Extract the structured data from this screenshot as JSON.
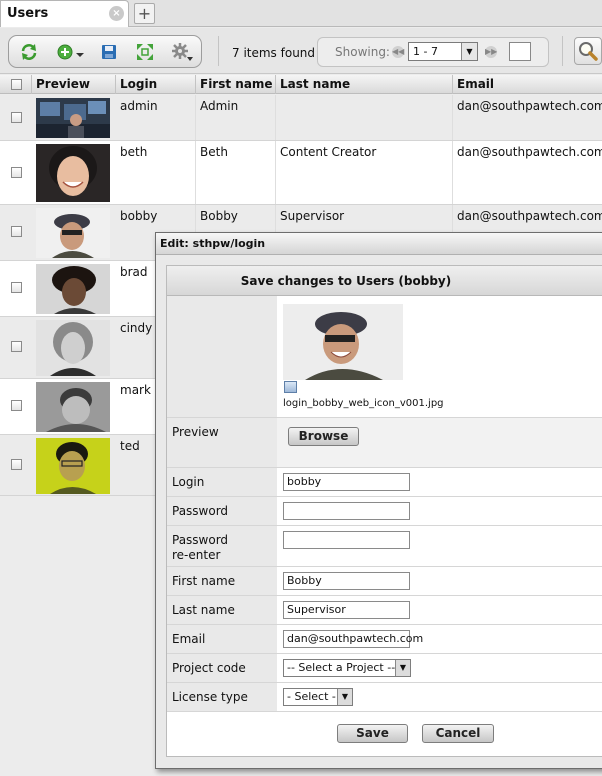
{
  "tab": {
    "title": "Users",
    "close": "×",
    "add": "+"
  },
  "toolbar": {
    "items_found": "7 items found",
    "showing_label": "Showing:",
    "page_range": "1 - 7",
    "page_input": ""
  },
  "table": {
    "headers": [
      "Preview",
      "Login",
      "First name",
      "Last name",
      "Email"
    ],
    "rows": [
      {
        "login": "admin",
        "first_name": "Admin",
        "last_name": "",
        "email": "dan@southpawtech.com"
      },
      {
        "login": "beth",
        "first_name": "Beth",
        "last_name": "Content Creator",
        "email": "dan@southpawtech.com"
      },
      {
        "login": "bobby",
        "first_name": "Bobby",
        "last_name": "Supervisor",
        "email": "dan@southpawtech.com"
      },
      {
        "login": "brad",
        "first_name": "",
        "last_name": "",
        "email": ""
      },
      {
        "login": "cindy",
        "first_name": "",
        "last_name": "",
        "email": ""
      },
      {
        "login": "mark",
        "first_name": "",
        "last_name": "",
        "email": ""
      },
      {
        "login": "ted",
        "first_name": "",
        "last_name": "",
        "email": ""
      }
    ]
  },
  "popup": {
    "title": "Edit: sthpw/login",
    "form_title": "Save changes to Users (bobby)",
    "filename": "login_bobby_web_icon_v001.jpg",
    "fields": {
      "preview_label": "Preview",
      "browse_label": "Browse",
      "login_label": "Login",
      "login_value": "bobby",
      "password_label": "Password",
      "password_value": "",
      "password_reenter_label_1": "Password",
      "password_reenter_label_2": "re-enter",
      "password_reenter_value": "",
      "first_name_label": "First name",
      "first_name_value": "Bobby",
      "last_name_label": "Last name",
      "last_name_value": "Supervisor",
      "email_label": "Email",
      "email_value": "dan@southpawtech.com",
      "project_code_label": "Project code",
      "project_code_value": "-- Select a Project --",
      "license_type_label": "License type",
      "license_type_value": "- Select -"
    },
    "save_label": "Save",
    "cancel_label": "Cancel"
  },
  "colors": {
    "accent_green": "#3b9b2f",
    "toolbar_bg": "#e6e6e6",
    "row_alt": "#ebebeb"
  },
  "icons": [
    "refresh-icon",
    "add-icon",
    "save-icon",
    "expand-icon",
    "gear-icon",
    "search-icon"
  ]
}
